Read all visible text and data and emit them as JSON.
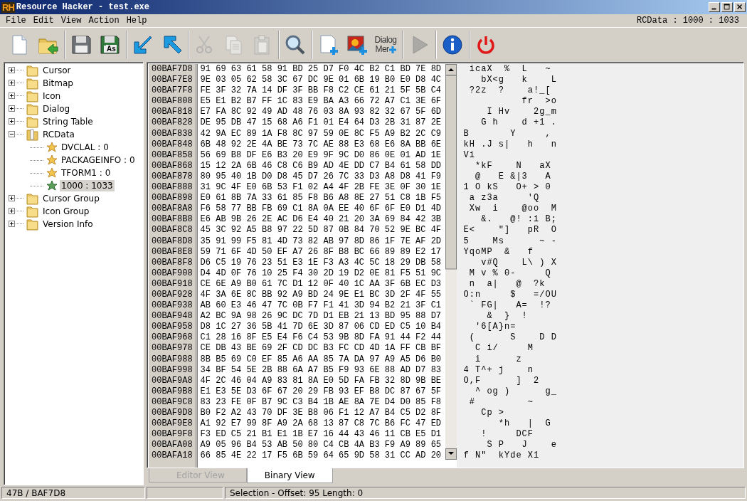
{
  "window": {
    "logo": "RH",
    "title": "Resource Hacker - test.exe"
  },
  "menu": {
    "items": [
      "File",
      "Edit",
      "View",
      "Action",
      "Help"
    ],
    "context": "RCData : 1000 : 1033"
  },
  "toolbar": {
    "groups": [
      {
        "items": [
          {
            "kind": "new",
            "disabled": false
          },
          {
            "kind": "open",
            "disabled": false
          }
        ]
      },
      {
        "items": [
          {
            "kind": "save",
            "disabled": false
          },
          {
            "kind": "save_as",
            "badge": "As",
            "disabled": false
          }
        ]
      },
      {
        "items": [
          {
            "kind": "arrow_down",
            "disabled": false
          },
          {
            "kind": "arrow_up",
            "disabled": false
          }
        ]
      },
      {
        "items": [
          {
            "kind": "cut",
            "disabled": true
          },
          {
            "kind": "copy",
            "disabled": true
          },
          {
            "kind": "paste",
            "disabled": true
          }
        ]
      },
      {
        "items": [
          {
            "kind": "search",
            "disabled": false
          }
        ]
      },
      {
        "items": [
          {
            "kind": "add_page",
            "disabled": false
          },
          {
            "kind": "add_image",
            "disabled": false
          },
          {
            "kind": "dialog",
            "label_lines": [
              "Dialog",
              "Mer"
            ],
            "disabled": false
          }
        ]
      },
      {
        "items": [
          {
            "kind": "play",
            "disabled": true
          }
        ]
      },
      {
        "items": [
          {
            "kind": "info",
            "disabled": false
          }
        ]
      },
      {
        "items": [
          {
            "kind": "power",
            "disabled": false
          }
        ]
      }
    ]
  },
  "tree": {
    "items": [
      {
        "label": "Cursor",
        "expanded": false,
        "selected": false
      },
      {
        "label": "Bitmap",
        "expanded": false,
        "selected": false
      },
      {
        "label": "Icon",
        "expanded": false,
        "selected": false
      },
      {
        "label": "Dialog",
        "expanded": false,
        "selected": false
      },
      {
        "label": "String Table",
        "expanded": false,
        "selected": false
      },
      {
        "label": "RCData",
        "expanded": true,
        "selected": false,
        "children": [
          {
            "label": "DVCLAL : 0",
            "selected": false
          },
          {
            "label": "PACKAGEINFO : 0",
            "selected": false
          },
          {
            "label": "TFORM1 : 0",
            "selected": false
          },
          {
            "label": "1000 : 1033",
            "selected": true
          }
        ]
      },
      {
        "label": "Cursor Group",
        "expanded": false,
        "selected": false
      },
      {
        "label": "Icon Group",
        "expanded": false,
        "selected": false
      },
      {
        "label": "Version Info",
        "expanded": false,
        "selected": false
      }
    ]
  },
  "hex_view": {
    "rows": [
      {
        "address": "00BAF7D8",
        "bytes": "91 69 63 61 58 91 BD 25 D7 F0 4C B2 C1 BD 7E 8D",
        "ascii": " icaX  %  L   ~"
      },
      {
        "address": "00BAF7E8",
        "bytes": "9E 03 05 62 58 3C 67 DC 9E 01 6B 19 B0 E0 D8 4C",
        "ascii": "   bX<g   k    L"
      },
      {
        "address": "00BAF7F8",
        "bytes": "FE 3F 32 7A 14 DF 3F BB F8 C2 CE 61 21 5F 5B C4",
        "ascii": " ?2z  ?    a!_["
      },
      {
        "address": "00BAF808",
        "bytes": "E5 E1 B2 B7 FF 1C 83 E9 BA A3 66 72 A7 C1 3E 6F",
        "ascii": "          fr  >o"
      },
      {
        "address": "00BAF818",
        "bytes": "E7 FA 8C 92 49 AD 48 76 03 8A 93 82 32 67 5F 6D",
        "ascii": "    I Hv    2g_m"
      },
      {
        "address": "00BAF828",
        "bytes": "DE 95 DB 47 15 68 A6 F1 01 E4 64 D3 2B 31 87 2E",
        "ascii": "   G h    d +1 ."
      },
      {
        "address": "00BAF838",
        "bytes": "42 9A EC 89 1A F8 8C 97 59 0E 8C F5 A9 B2 2C C9",
        "ascii": "B       Y     ,"
      },
      {
        "address": "00BAF848",
        "bytes": "6B 48 92 2E 4A BE 73 7C AE 88 E3 68 E6 8A BB 6E",
        "ascii": "kH .J s|   h   n"
      },
      {
        "address": "00BAF858",
        "bytes": "56 69 B8 DF E6 B3 20 E9 9F 9C D0 86 0E 01 AD 1E",
        "ascii": "Vi"
      },
      {
        "address": "00BAF868",
        "bytes": "15 12 2A 6B 46 C8 C6 B9 AD 4E DD C7 B4 61 58 DD",
        "ascii": "  *kF    N   aX"
      },
      {
        "address": "00BAF878",
        "bytes": "80 95 40 1B D0 D8 45 D7 26 7C 33 D3 A8 D8 41 F9",
        "ascii": "  @   E &|3   A"
      },
      {
        "address": "00BAF888",
        "bytes": "31 9C 4F E0 6B 53 F1 02 A4 4F 2B FE 3E 0F 30 1E",
        "ascii": "1 O kS   O+ > 0"
      },
      {
        "address": "00BAF898",
        "bytes": "E0 61 8B 7A 33 61 85 F8 B6 A8 8E 27 51 C8 1B F5",
        "ascii": " a z3a     'Q"
      },
      {
        "address": "00BAF8A8",
        "bytes": "F6 58 77 BB FB 69 C1 8A 0A EE 40 6F 6F E0 D1 4D",
        "ascii": " Xw  i    @oo  M"
      },
      {
        "address": "00BAF8B8",
        "bytes": "E6 AB 9B 26 2E AC D6 E4 40 21 20 3A 69 84 42 3B",
        "ascii": "   &.   @! :i B;"
      },
      {
        "address": "00BAF8C8",
        "bytes": "45 3C 92 A5 B8 97 22 5D 87 0B 84 70 52 9E BC 4F",
        "ascii": "E<    \"]   pR  O"
      },
      {
        "address": "00BAF8D8",
        "bytes": "35 91 99 F5 81 4D 73 82 AB 97 8D 86 1F 7E AF 2D",
        "ascii": "5    Ms      ~ -"
      },
      {
        "address": "00BAF8E8",
        "bytes": "59 71 6F 4D 50 EF A7 26 8F B8 BC 66 89 89 E2 17",
        "ascii": "YqoMP  &   f"
      },
      {
        "address": "00BAF8F8",
        "bytes": "D6 C5 19 76 23 51 E3 1E F3 A3 4C 5C 18 29 DB 58",
        "ascii": "   v#Q    L\\ ) X"
      },
      {
        "address": "00BAF908",
        "bytes": "D4 4D 0F 76 10 25 F4 30 2D 19 D2 0E 81 F5 51 9C",
        "ascii": " M v % 0-     Q"
      },
      {
        "address": "00BAF918",
        "bytes": "CE 6E A9 B0 61 7C D1 12 0F 40 1C AA 3F 6B EC D3",
        "ascii": " n  a|   @  ?k"
      },
      {
        "address": "00BAF928",
        "bytes": "4F 3A 6E 8C BB 92 A9 BD 24 9E E1 BC 3D 2F 4F 55",
        "ascii": "O:n     $   =/OU"
      },
      {
        "address": "00BAF938",
        "bytes": "AB 60 E3 46 47 7C 0B F7 F1 41 3D 94 B2 21 3F C1",
        "ascii": " ` FG|   A=  !?"
      },
      {
        "address": "00BAF948",
        "bytes": "A2 BC 9A 98 26 9C DC 7D D1 EB 21 13 BD 95 88 D7",
        "ascii": "    &  }  !"
      },
      {
        "address": "00BAF958",
        "bytes": "D8 1C 27 36 5B 41 7D 6E 3D 87 06 CD ED C5 10 B4",
        "ascii": "  '6[A}n="
      },
      {
        "address": "00BAF968",
        "bytes": "C1 28 16 8F E5 E4 F6 C4 53 9B 8D FA 91 44 F2 44",
        "ascii": " (      S    D D"
      },
      {
        "address": "00BAF978",
        "bytes": "CE DB 43 BE 69 2F CD DC B3 FC CD 4D 1A FF CB BF",
        "ascii": "  C i/     M"
      },
      {
        "address": "00BAF988",
        "bytes": "8B B5 69 C0 EF 85 A6 AA 85 7A DA 97 A9 A5 D6 B0",
        "ascii": "  i      z"
      },
      {
        "address": "00BAF998",
        "bytes": "34 BF 54 5E 2B 88 6A A7 B5 F9 93 6E 88 AD D7 83",
        "ascii": "4 T^+ j    n"
      },
      {
        "address": "00BAF9A8",
        "bytes": "4F 2C 46 04 A9 83 81 8A E0 5D FA FB 32 8D 9B BE",
        "ascii": "O,F      ]  2"
      },
      {
        "address": "00BAF9B8",
        "bytes": "E1 E3 5E D3 6F 67 20 29 FB 93 EF B8 DC 87 67 5F",
        "ascii": "  ^ og )      g_"
      },
      {
        "address": "00BAF9C8",
        "bytes": "83 23 FE 0F B7 9C C3 B4 1B AE 8A 7E D4 D0 85 F8",
        "ascii": " #         ~"
      },
      {
        "address": "00BAF9D8",
        "bytes": "B0 F2 A2 43 70 DF 3E B8 06 F1 12 A7 B4 C5 D2 8F",
        "ascii": "   Cp >"
      },
      {
        "address": "00BAF9E8",
        "bytes": "A1 92 E7 99 8F A9 2A 68 13 87 C8 7C B6 FC 47 ED",
        "ascii": "      *h   |  G"
      },
      {
        "address": "00BAF9F8",
        "bytes": "F3 ED C5 21 B1 E1 1B E7 16 44 43 46 11 CB E5 D1",
        "ascii": "   !     DCF"
      },
      {
        "address": "00BAFA08",
        "bytes": "A9 05 96 B4 53 AB 50 80 C4 CB 4A B3 F9 A9 89 65",
        "ascii": "    S P   J    e"
      },
      {
        "address": "00BAFA18",
        "bytes": "66 85 4E 22 17 F5 6B 59 64 65 9D 58 31 CC AD 20",
        "ascii": "f N\"  kYde X1"
      }
    ]
  },
  "view_tabs": [
    {
      "label": "Editor View",
      "selected": false,
      "disabled": true
    },
    {
      "label": "Binary View",
      "selected": true,
      "disabled": false
    }
  ],
  "status_bar": {
    "position": "47B / BAF7D8",
    "selection": "Selection - Offset: 95 Length: 0"
  }
}
